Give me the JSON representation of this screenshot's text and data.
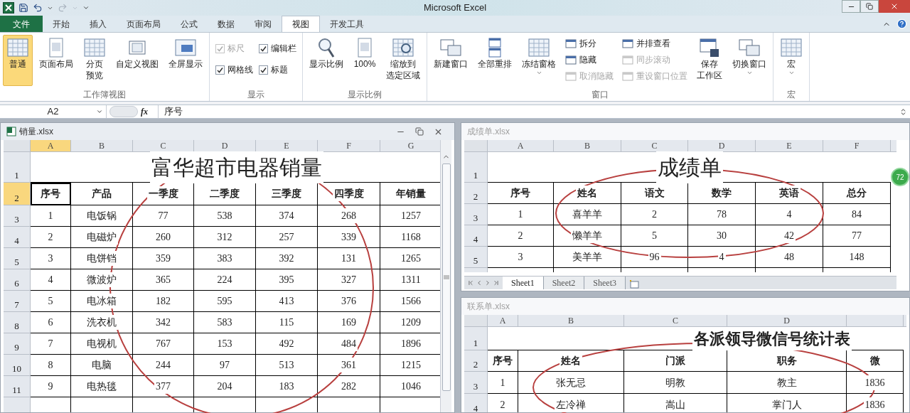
{
  "window": {
    "title": "Microsoft Excel"
  },
  "tabs": [
    {
      "label": "文件",
      "kind": "file",
      "selected": false
    },
    {
      "label": "开始",
      "kind": "tab",
      "selected": false
    },
    {
      "label": "插入",
      "kind": "tab",
      "selected": false
    },
    {
      "label": "页面布局",
      "kind": "tab",
      "selected": false
    },
    {
      "label": "公式",
      "kind": "tab",
      "selected": false
    },
    {
      "label": "数据",
      "kind": "tab",
      "selected": false
    },
    {
      "label": "审阅",
      "kind": "tab",
      "selected": false
    },
    {
      "label": "视图",
      "kind": "tab",
      "selected": true
    },
    {
      "label": "开发工具",
      "kind": "tab",
      "selected": false
    }
  ],
  "ribbon": [
    {
      "label": "工作簿视图",
      "items": [
        {
          "kind": "large",
          "label": "普通",
          "selected": true,
          "dropdown": false
        },
        {
          "kind": "large",
          "label": "页面布局",
          "selected": false,
          "dropdown": false
        },
        {
          "kind": "large",
          "label": [
            "分页",
            "预览"
          ],
          "selected": false,
          "dropdown": false
        },
        {
          "kind": "large",
          "label": "自定义视图",
          "selected": false,
          "dropdown": false
        },
        {
          "kind": "large",
          "label": "全屏显示",
          "selected": false,
          "dropdown": false
        }
      ]
    },
    {
      "label": "显示",
      "items": [
        {
          "kind": "check",
          "label": "标尺",
          "checked": true,
          "disabled": true
        },
        {
          "kind": "check",
          "label": "编辑栏",
          "checked": true,
          "disabled": false
        },
        {
          "kind": "check",
          "label": "网格线",
          "checked": true,
          "disabled": false
        },
        {
          "kind": "check",
          "label": "标题",
          "checked": true,
          "disabled": false
        }
      ]
    },
    {
      "label": "显示比例",
      "items": [
        {
          "kind": "large",
          "label": "显示比例",
          "selected": false,
          "dropdown": false
        },
        {
          "kind": "large",
          "label": "100%",
          "selected": false,
          "dropdown": false
        },
        {
          "kind": "large",
          "label": [
            "缩放到",
            "选定区域"
          ],
          "selected": false,
          "dropdown": false
        }
      ]
    },
    {
      "label": "窗口",
      "items": [
        {
          "kind": "large",
          "label": "新建窗口",
          "selected": false,
          "dropdown": false
        },
        {
          "kind": "large",
          "label": "全部重排",
          "selected": false,
          "dropdown": false
        },
        {
          "kind": "large",
          "label": "冻结窗格",
          "selected": false,
          "dropdown": true
        },
        {
          "kind": "small",
          "label": "拆分",
          "disabled": false
        },
        {
          "kind": "small",
          "label": "隐藏",
          "disabled": false
        },
        {
          "kind": "small",
          "label": "取消隐藏",
          "disabled": true
        },
        {
          "kind": "small",
          "label": "并排查看",
          "disabled": false
        },
        {
          "kind": "small",
          "label": "同步滚动",
          "disabled": true
        },
        {
          "kind": "small",
          "label": "重设窗口位置",
          "disabled": true
        },
        {
          "kind": "large",
          "label": [
            "保存",
            "工作区"
          ],
          "selected": false,
          "dropdown": false
        },
        {
          "kind": "large",
          "label": "切换窗口",
          "selected": false,
          "dropdown": true
        }
      ]
    },
    {
      "label": "宏",
      "items": [
        {
          "kind": "large",
          "label": "宏",
          "selected": false,
          "dropdown": true
        }
      ]
    }
  ],
  "formula_bar": {
    "name_box": "A2",
    "fx_label": "fx",
    "value": "序号"
  },
  "workbooks": [
    {
      "file": "销量.xlsx",
      "active": true,
      "columns": [
        {
          "label": "A",
          "selected": true
        },
        {
          "label": "B",
          "selected": false
        },
        {
          "label": "C",
          "selected": false
        },
        {
          "label": "D",
          "selected": false
        },
        {
          "label": "E",
          "selected": false
        },
        {
          "label": "F",
          "selected": false
        },
        {
          "label": "G",
          "selected": false
        }
      ],
      "title_row": {
        "number": "1",
        "text": "富华超市电器销量"
      },
      "rows": [
        {
          "number": "2",
          "selected": true,
          "kind": "header",
          "cells": [
            "序号",
            "产品",
            "一季度",
            "二季度",
            "三季度",
            "四季度",
            "年销量"
          ]
        },
        {
          "number": "3",
          "selected": false,
          "kind": "data",
          "cells": [
            "1",
            "电饭锅",
            "77",
            "538",
            "374",
            "268",
            "1257"
          ]
        },
        {
          "number": "4",
          "selected": false,
          "kind": "data",
          "cells": [
            "2",
            "电磁炉",
            "260",
            "312",
            "257",
            "339",
            "1168"
          ]
        },
        {
          "number": "5",
          "selected": false,
          "kind": "data",
          "cells": [
            "3",
            "电饼铛",
            "359",
            "383",
            "392",
            "131",
            "1265"
          ]
        },
        {
          "number": "6",
          "selected": false,
          "kind": "data",
          "cells": [
            "4",
            "微波炉",
            "365",
            "224",
            "395",
            "327",
            "1311"
          ]
        },
        {
          "number": "7",
          "selected": false,
          "kind": "data",
          "cells": [
            "5",
            "电冰箱",
            "182",
            "595",
            "413",
            "376",
            "1566"
          ]
        },
        {
          "number": "8",
          "selected": false,
          "kind": "data",
          "cells": [
            "6",
            "洗衣机",
            "342",
            "583",
            "115",
            "169",
            "1209"
          ]
        },
        {
          "number": "9",
          "selected": false,
          "kind": "data",
          "cells": [
            "7",
            "电视机",
            "767",
            "153",
            "492",
            "484",
            "1896"
          ]
        },
        {
          "number": "10",
          "selected": false,
          "kind": "data",
          "cells": [
            "8",
            "电脑",
            "244",
            "97",
            "513",
            "361",
            "1215"
          ]
        },
        {
          "number": "11",
          "selected": false,
          "kind": "data",
          "cells": [
            "9",
            "电热毯",
            "377",
            "204",
            "183",
            "282",
            "1046"
          ]
        }
      ]
    },
    {
      "file": "成绩单.xlsx",
      "active": false,
      "columns": [
        {
          "label": "A",
          "selected": false
        },
        {
          "label": "B",
          "selected": false
        },
        {
          "label": "C",
          "selected": false
        },
        {
          "label": "D",
          "selected": false
        },
        {
          "label": "E",
          "selected": false
        },
        {
          "label": "F",
          "selected": false
        }
      ],
      "title_row": {
        "number": "1",
        "text": "成绩单"
      },
      "rows": [
        {
          "number": "2",
          "selected": false,
          "kind": "header",
          "cells": [
            "序号",
            "姓名",
            "语文",
            "数学",
            "英语",
            "总分"
          ]
        },
        {
          "number": "3",
          "selected": false,
          "kind": "data",
          "cells": [
            "1",
            "喜羊羊",
            "2",
            "78",
            "4",
            "84"
          ]
        },
        {
          "number": "4",
          "selected": false,
          "kind": "data",
          "cells": [
            "2",
            "懒羊羊",
            "5",
            "30",
            "42",
            "77"
          ]
        },
        {
          "number": "5",
          "selected": false,
          "kind": "data",
          "cells": [
            "3",
            "美羊羊",
            "96",
            "4",
            "48",
            "148"
          ]
        }
      ],
      "sheets": [
        {
          "label": "Sheet1",
          "selected": true
        },
        {
          "label": "Sheet2",
          "selected": false
        },
        {
          "label": "Sheet3",
          "selected": false
        }
      ]
    },
    {
      "file": "联系单.xlsx",
      "active": false,
      "columns": [
        {
          "label": "A",
          "selected": false
        },
        {
          "label": "B",
          "selected": false
        },
        {
          "label": "C",
          "selected": false
        },
        {
          "label": "D",
          "selected": false
        }
      ],
      "title_row": {
        "number": "1",
        "text": "各派领导微信号统计表"
      },
      "rows": [
        {
          "number": "2",
          "selected": false,
          "kind": "header",
          "cells": [
            "序号",
            "姓名",
            "门派",
            "职务",
            "微"
          ]
        },
        {
          "number": "3",
          "selected": false,
          "kind": "data",
          "cells": [
            "1",
            "张无忌",
            "明教",
            "教主",
            "1836"
          ]
        },
        {
          "number": "4",
          "selected": false,
          "kind": "data",
          "cells": [
            "2",
            "左冷禅",
            "嵩山",
            "掌门人",
            "1836"
          ]
        }
      ]
    }
  ],
  "float_badge": "72"
}
